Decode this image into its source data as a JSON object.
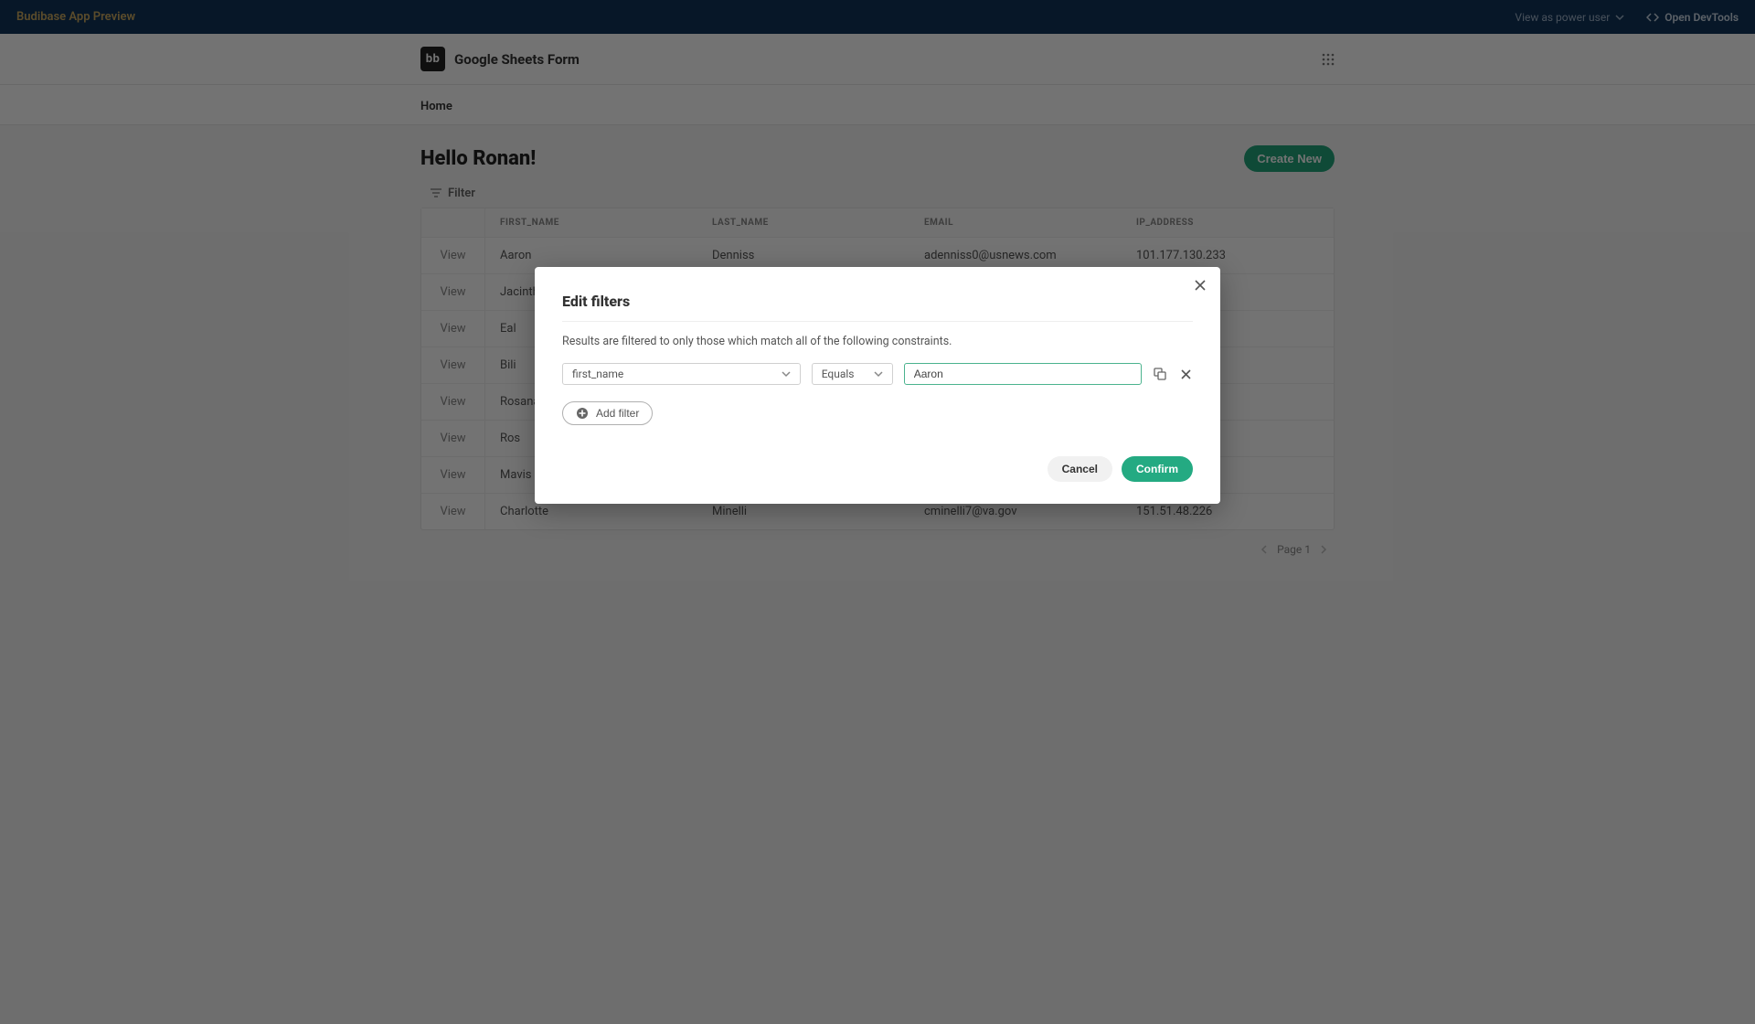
{
  "preview_bar": {
    "title": "Budibase App Preview",
    "view_as": "View as power user",
    "open_devtools": "Open DevTools"
  },
  "app": {
    "logo_text": "bb",
    "name": "Google Sheets Form"
  },
  "nav": {
    "home": "Home"
  },
  "page": {
    "title": "Hello Ronan!",
    "create_new": "Create New",
    "filter_label": "Filter",
    "view_label": "View",
    "columns": {
      "first_name": "FIRST_NAME",
      "last_name": "LAST_NAME",
      "email": "EMAIL",
      "ip": "IP_ADDRESS"
    },
    "rows": [
      {
        "first_name": "Aaron",
        "last_name": "Denniss",
        "email": "adenniss0@usnews.com",
        "ip": "101.177.130.233"
      },
      {
        "first_name": "Jacintha",
        "last_name": "",
        "email": "",
        "ip": ""
      },
      {
        "first_name": "Eal",
        "last_name": "",
        "email": "",
        "ip": ""
      },
      {
        "first_name": "Bili",
        "last_name": "",
        "email": "",
        "ip": ""
      },
      {
        "first_name": "Rosana",
        "last_name": "",
        "email": "",
        "ip": ""
      },
      {
        "first_name": "Ros",
        "last_name": "",
        "email": "",
        "ip": ""
      },
      {
        "first_name": "Mavis",
        "last_name": "",
        "email": "",
        "ip": ""
      },
      {
        "first_name": "Charlotte",
        "last_name": "Minelli",
        "email": "cminelli7@va.gov",
        "ip": "151.51.48.226"
      }
    ],
    "pagination": "Page 1"
  },
  "modal": {
    "title": "Edit filters",
    "desc": "Results are filtered to only those which match all of the following constraints.",
    "field": "first_name",
    "operator": "Equals",
    "value": "Aaron",
    "add_filter": "Add filter",
    "cancel": "Cancel",
    "confirm": "Confirm"
  }
}
